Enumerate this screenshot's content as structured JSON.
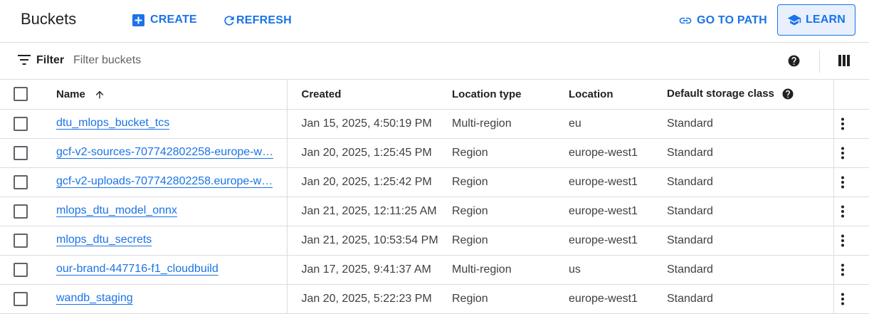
{
  "header": {
    "title": "Buckets",
    "create_label": "CREATE",
    "refresh_label": "REFRESH",
    "go_to_path_label": "GO TO PATH",
    "learn_label": "LEARN"
  },
  "filter": {
    "label": "Filter",
    "placeholder": "Filter buckets"
  },
  "table": {
    "columns": {
      "name": "Name",
      "created": "Created",
      "location_type": "Location type",
      "location": "Location",
      "storage_class": "Default storage class"
    },
    "sort": "ascending",
    "rows": [
      {
        "name": "dtu_mlops_bucket_tcs",
        "created": "Jan 15, 2025, 4:50:19 PM",
        "location_type": "Multi-region",
        "location": "eu",
        "storage_class": "Standard"
      },
      {
        "name": "gcf-v2-sources-707742802258-europe-w…",
        "created": "Jan 20, 2025, 1:25:45 PM",
        "location_type": "Region",
        "location": "europe-west1",
        "storage_class": "Standard"
      },
      {
        "name": "gcf-v2-uploads-707742802258.europe-w…",
        "created": "Jan 20, 2025, 1:25:42 PM",
        "location_type": "Region",
        "location": "europe-west1",
        "storage_class": "Standard"
      },
      {
        "name": "mlops_dtu_model_onnx",
        "created": "Jan 21, 2025, 12:11:25 AM",
        "location_type": "Region",
        "location": "europe-west1",
        "storage_class": "Standard"
      },
      {
        "name": "mlops_dtu_secrets",
        "created": "Jan 21, 2025, 10:53:54 PM",
        "location_type": "Region",
        "location": "europe-west1",
        "storage_class": "Standard"
      },
      {
        "name": "our-brand-447716-f1_cloudbuild",
        "created": "Jan 17, 2025, 9:41:37 AM",
        "location_type": "Multi-region",
        "location": "us",
        "storage_class": "Standard"
      },
      {
        "name": "wandb_staging",
        "created": "Jan 20, 2025, 5:22:23 PM",
        "location_type": "Region",
        "location": "europe-west1",
        "storage_class": "Standard"
      }
    ]
  },
  "colors": {
    "accent": "#1a73e8",
    "learn_bg": "#e8f0fe",
    "divider": "#dadce0",
    "text": "#202124"
  },
  "icons": {
    "create": "add-box-icon",
    "refresh": "refresh-icon",
    "go_to_path": "link-icon",
    "learn": "school-icon",
    "filter": "filter-icon",
    "help": "help-icon",
    "columns": "column-display-icon",
    "sort": "arrow-up-icon",
    "row_menu": "more-vert-icon"
  }
}
